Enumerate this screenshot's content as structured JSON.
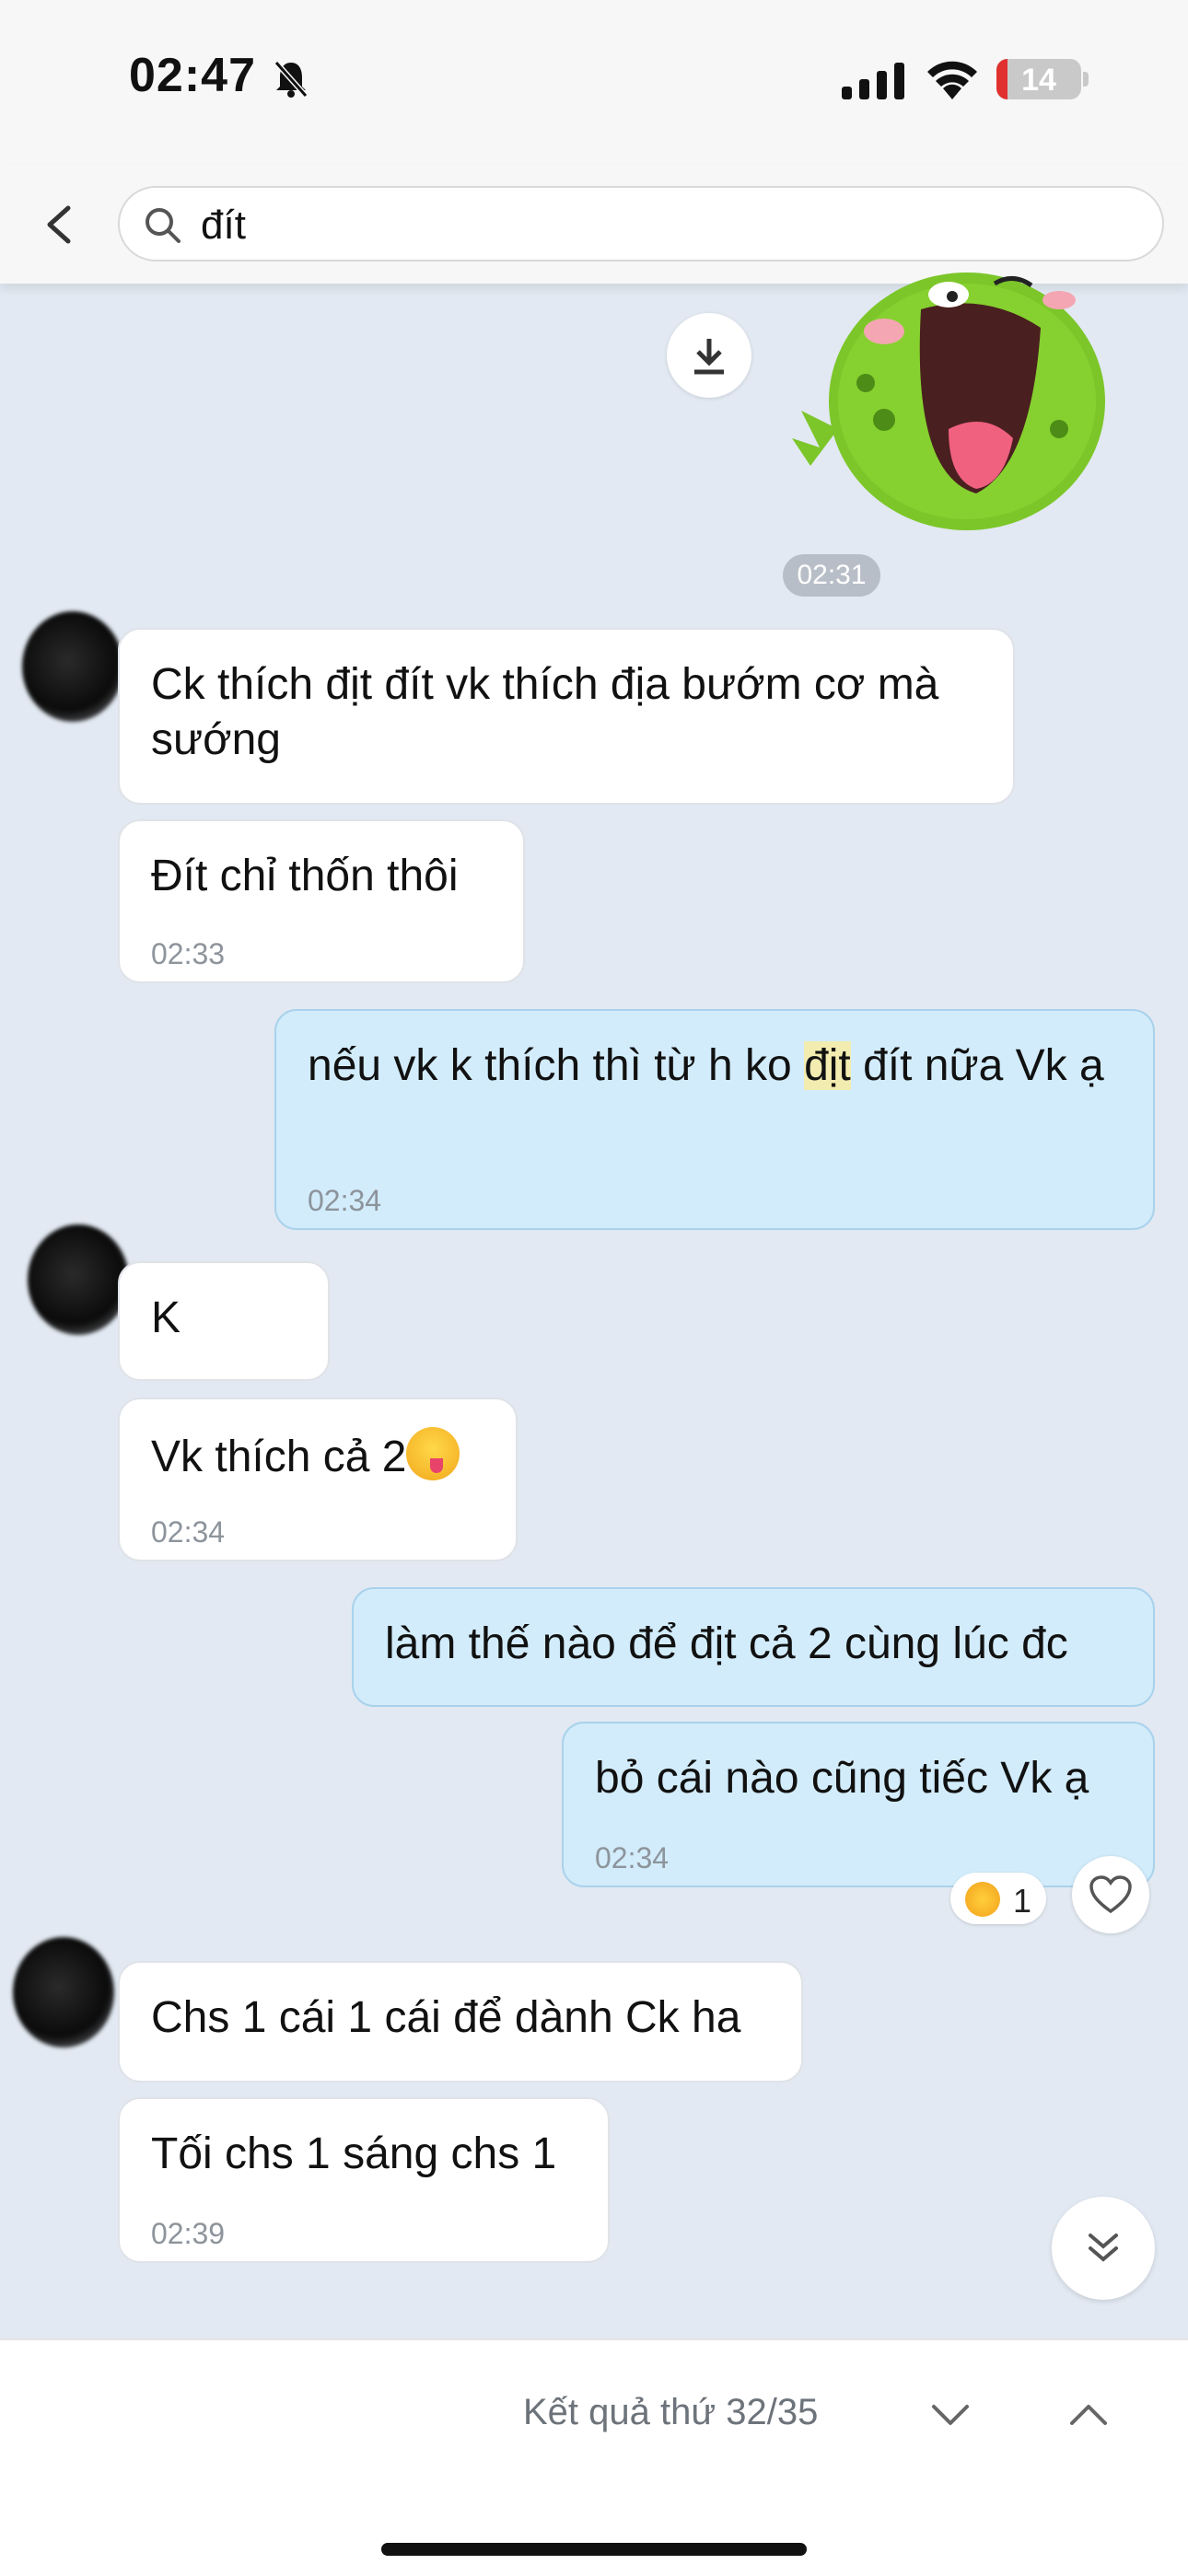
{
  "status_bar": {
    "time": "02:47",
    "battery": "14"
  },
  "search": {
    "query": "đít"
  },
  "messages": [
    {
      "id": "m1",
      "time_divider": "02:31"
    },
    {
      "id": "m2",
      "text": "Ck thích địt đít vk thích địa bướm cơ mà sướng"
    },
    {
      "id": "m3",
      "text": "Đít chỉ thốn thôi",
      "time": "02:33"
    },
    {
      "id": "m4",
      "text_before": "nếu vk k thích thì từ h ko ",
      "highlight": "địt",
      "text_after": " đít nữa Vk ạ",
      "time": "02:34"
    },
    {
      "id": "m5",
      "text": "K"
    },
    {
      "id": "m6",
      "text": "Vk thích cả 2",
      "time": "02:34"
    },
    {
      "id": "m7",
      "text": "làm thế nào để địt cả 2 cùng lúc đc"
    },
    {
      "id": "m8",
      "text": "bỏ cái nào cũng tiếc Vk ạ",
      "time": "02:34",
      "reaction_count": "1"
    },
    {
      "id": "m9",
      "text": "Chs 1 cái 1 cái để dành Ck ha"
    },
    {
      "id": "m10",
      "text": "Tối chs 1 sáng chs 1",
      "time": "02:39"
    }
  ],
  "footer": {
    "result_label": "Kết quả thứ 32/35"
  },
  "icons": [
    "bell-muted-icon",
    "cellular-icon",
    "wifi-icon",
    "back-chevron-icon",
    "search-icon",
    "download-icon",
    "heart-icon",
    "double-chevron-down-icon",
    "chevron-down-icon",
    "chevron-up-icon"
  ]
}
